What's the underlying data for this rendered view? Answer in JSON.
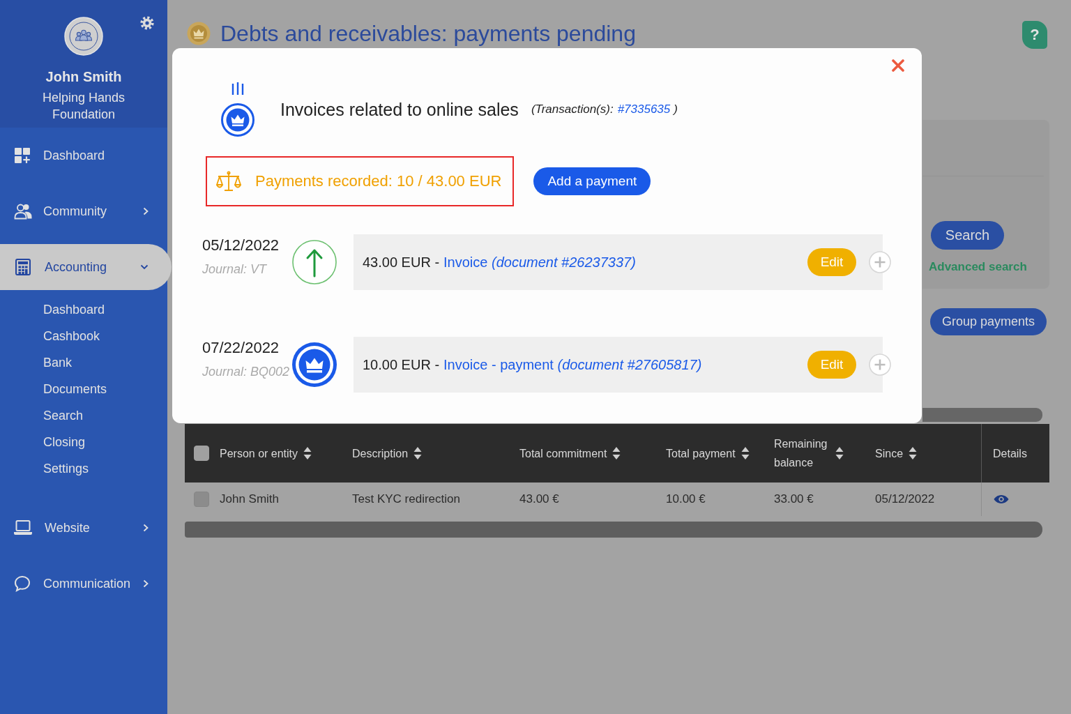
{
  "sidebar": {
    "user": {
      "name": "John Smith",
      "organization": "Helping Hands Foundation"
    },
    "items": [
      {
        "kind": "link",
        "label": "Dashboard",
        "selected": false
      },
      {
        "kind": "group",
        "label": "Community",
        "selected": false,
        "expanded": false
      },
      {
        "kind": "group",
        "label": "Accounting",
        "selected": true,
        "expanded": true,
        "children": [
          {
            "label": "Dashboard",
            "selected": false
          },
          {
            "label": "Cashbook",
            "selected": false
          },
          {
            "label": "Bank",
            "selected": false
          },
          {
            "label": "Documents",
            "selected": false
          },
          {
            "label": "Search",
            "selected": false
          },
          {
            "label": "Closing",
            "selected": false
          },
          {
            "label": "Settings",
            "selected": false
          }
        ]
      },
      {
        "kind": "group",
        "label": "Website",
        "selected": false,
        "expanded": false
      },
      {
        "kind": "group",
        "label": "Communication",
        "selected": false,
        "expanded": false
      }
    ]
  },
  "page": {
    "title": "Debts and receivables: payments pending",
    "help_button": "?"
  },
  "filters": {
    "search_button": "Search",
    "advanced_search_link": "Advanced search"
  },
  "actions": {
    "group_payments_button": "Group payments"
  },
  "table": {
    "select_all": {
      "checked": false
    },
    "columns": [
      {
        "label": "Person or entity",
        "sortable": true
      },
      {
        "label": "Description",
        "sortable": true
      },
      {
        "label": "Total commitment",
        "sortable": true
      },
      {
        "label": "Total payment",
        "sortable": true
      },
      {
        "label": "Remaining balance",
        "sortable": true
      },
      {
        "label": "Since",
        "sortable": true
      },
      {
        "label": "Details",
        "sortable": false
      }
    ],
    "rows": [
      {
        "checked": false,
        "cells": [
          "John Smith",
          "Test KYC redirection",
          "43.00 €",
          "10.00 €",
          "33.00 €",
          "05/12/2022"
        ]
      }
    ]
  },
  "modal": {
    "title": "Invoices related to online sales",
    "transaction": {
      "prefix": "(Transaction(s):",
      "link": "#7335635",
      "suffix": ")"
    },
    "summary": "Payments recorded: 10 / 43.00 EUR",
    "add_button": "Add a payment",
    "entries": [
      {
        "kind": "invoice",
        "date": "05/12/2022",
        "journal": "Journal: VT",
        "amount": "43.00 EUR -",
        "link": "Invoice *(document #26237337)*",
        "edit_button": "Edit"
      },
      {
        "kind": "payment",
        "date": "07/22/2022",
        "journal": "Journal: BQ002",
        "amount": "10.00 EUR -",
        "link": "Invoice - payment *(document #27605817)*",
        "edit_button": "Edit"
      }
    ]
  }
}
